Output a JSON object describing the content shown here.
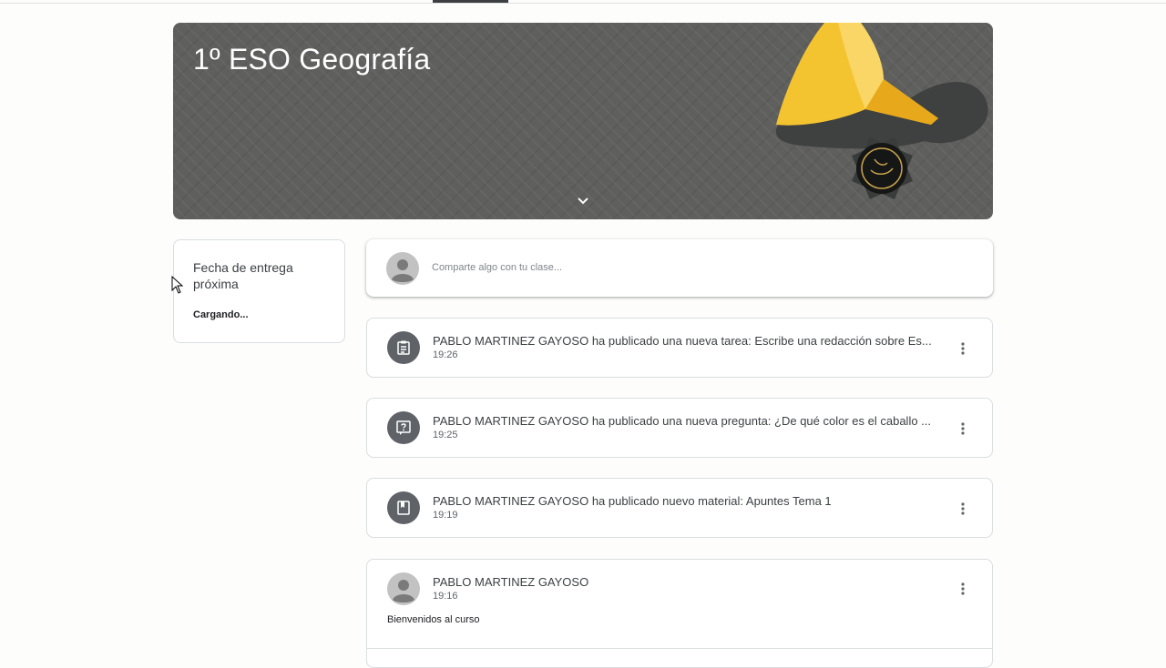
{
  "class": {
    "title": "1º ESO Geografía"
  },
  "upcoming": {
    "title": "Fecha de entrega próxima",
    "status": "Cargando..."
  },
  "share": {
    "placeholder": "Comparte algo con tu clase..."
  },
  "stream": [
    {
      "icon": "assignment-icon",
      "title": "PABLO MARTINEZ GAYOSO ha publicado una nueva tarea: Escribe una redacción sobre Es...",
      "time": "19:26"
    },
    {
      "icon": "question-icon",
      "title": "PABLO MARTINEZ GAYOSO ha publicado una nueva pregunta: ¿De qué color es el caballo ...",
      "time": "19:25"
    },
    {
      "icon": "material-icon",
      "title": "PABLO MARTINEZ GAYOSO ha publicado nuevo material: Apuntes Tema 1",
      "time": "19:19"
    }
  ],
  "announcement": {
    "author": "PABLO MARTINEZ GAYOSO",
    "time": "19:16",
    "body": "Bienvenidos al curso"
  },
  "colors": {
    "banner": "#5f5f5d",
    "icon_circle": "#5f6368",
    "accent_yellow": "#f4c430"
  }
}
